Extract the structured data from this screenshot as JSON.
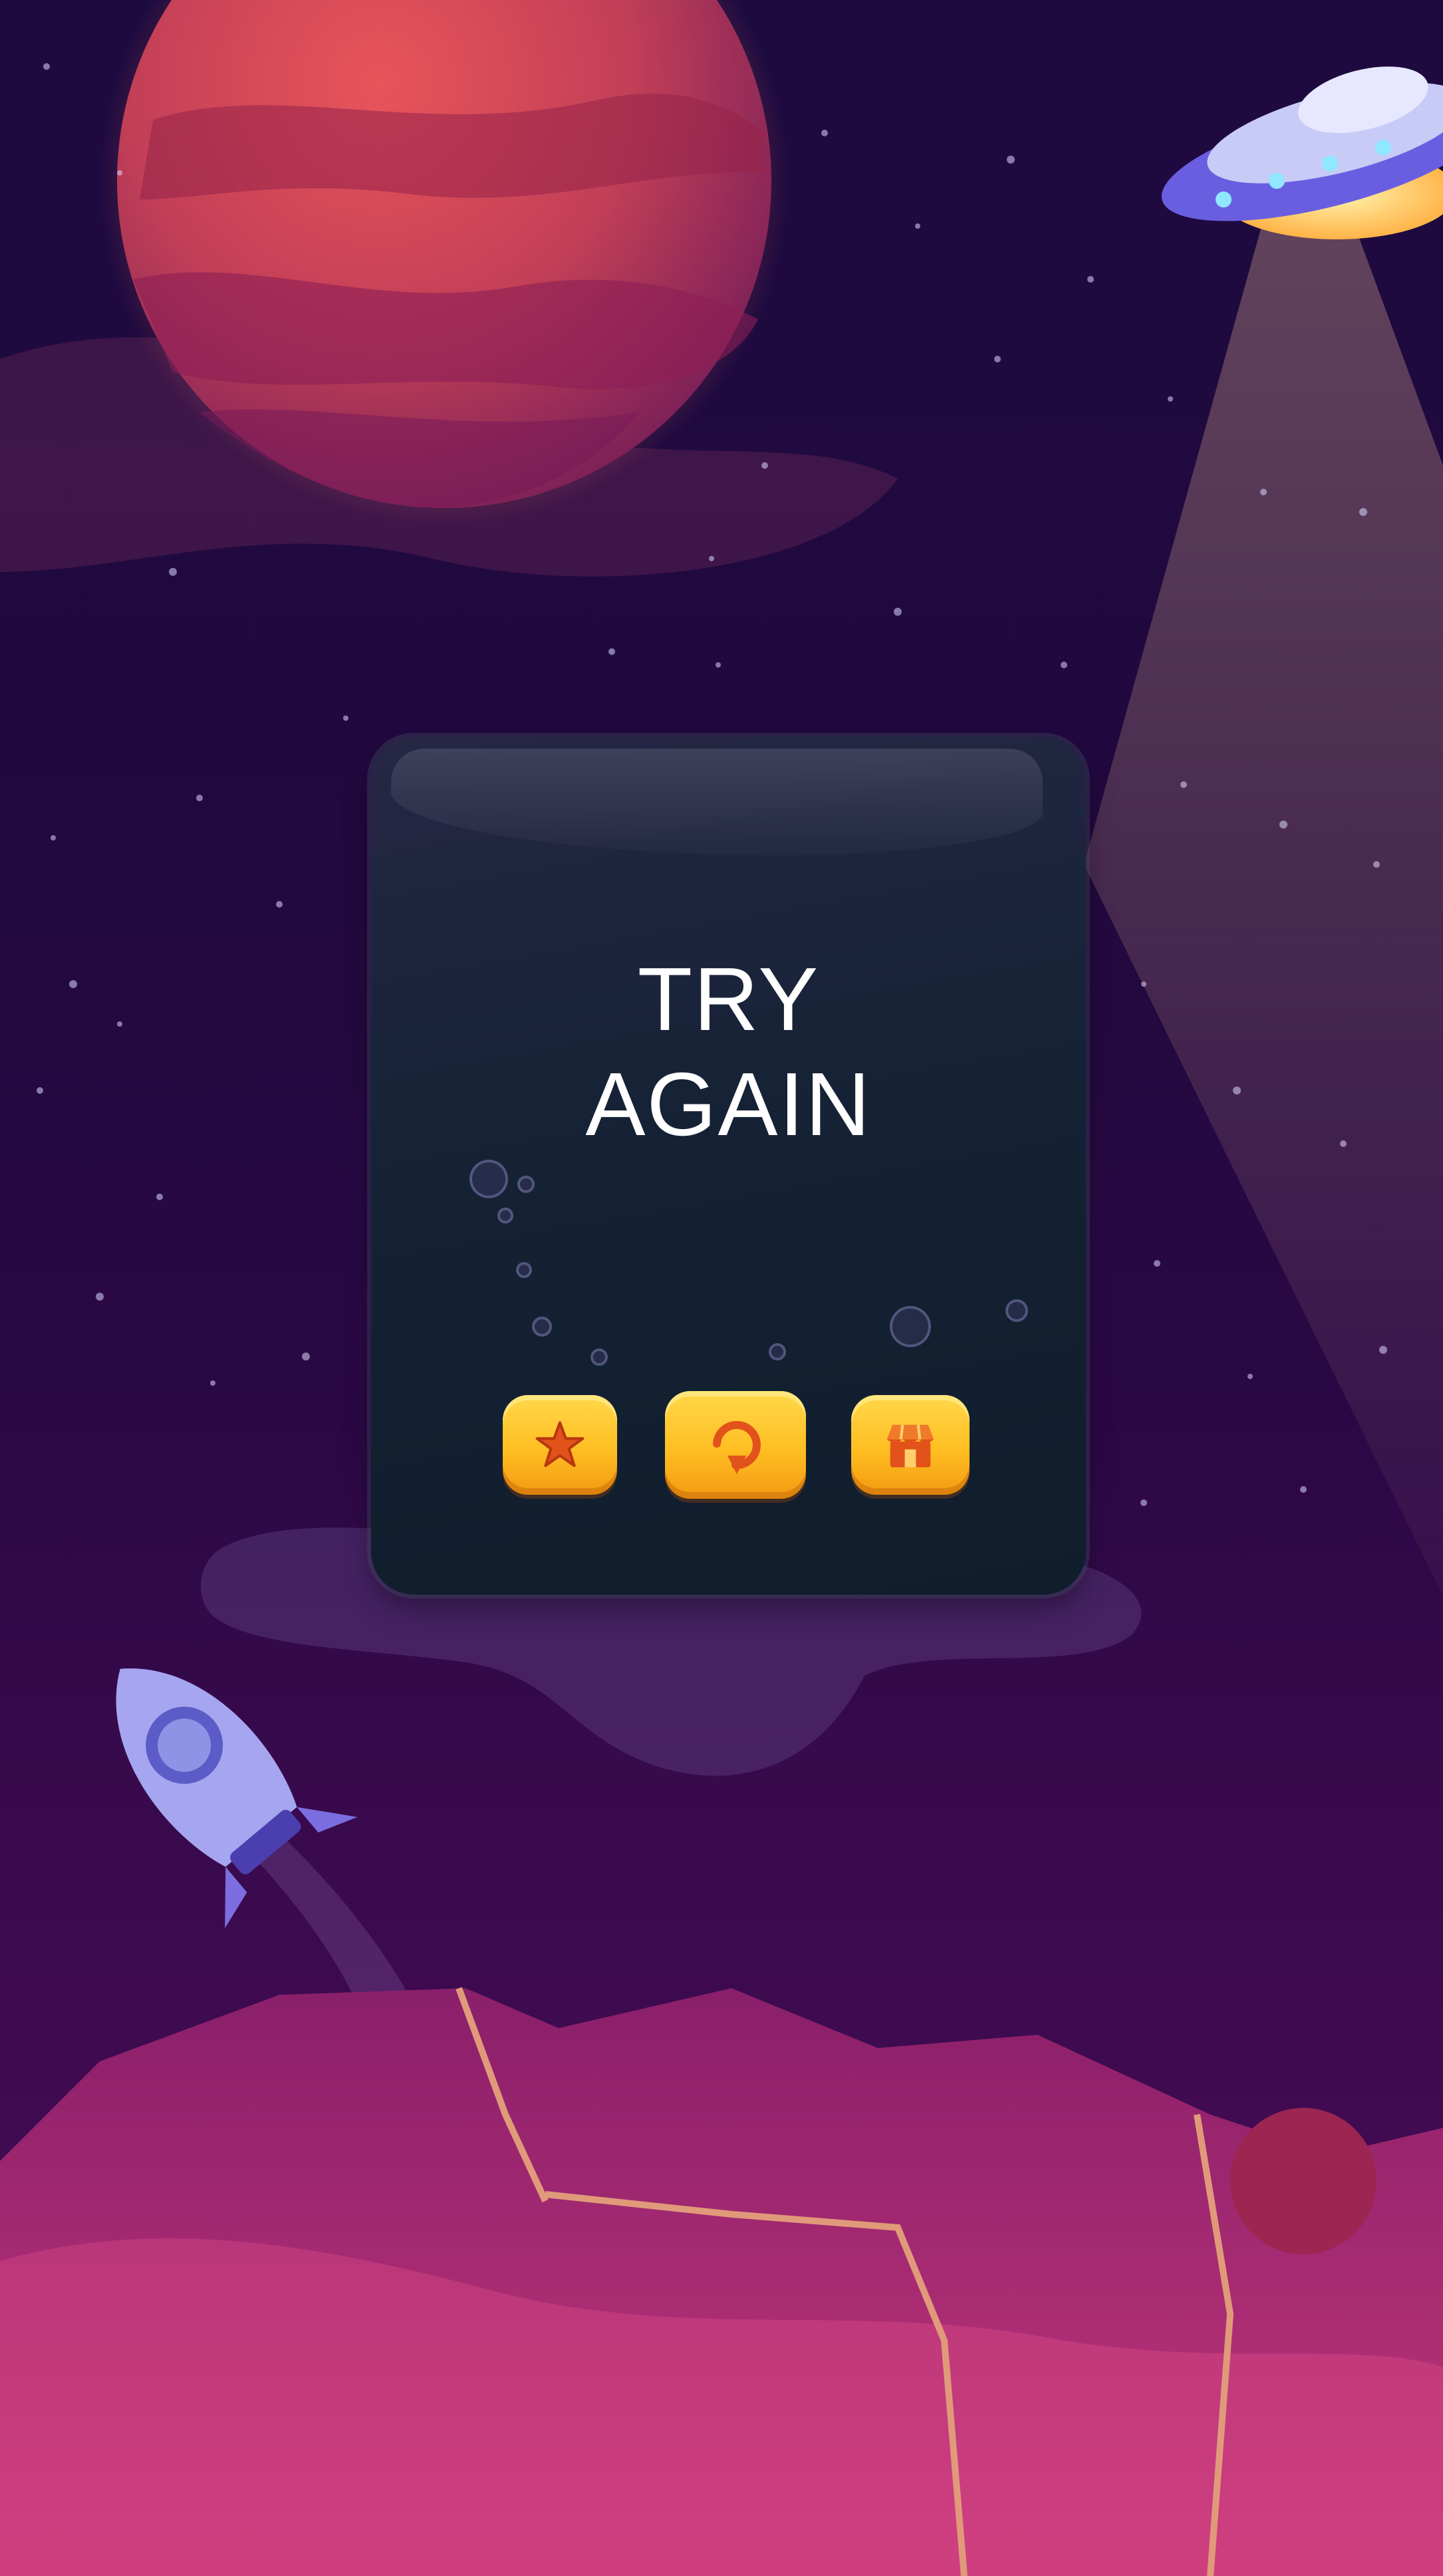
{
  "screen": {
    "title_line1": "TRY",
    "title_line2": "AGAIN"
  },
  "buttons": [
    {
      "id": "rate",
      "icon": "star-icon"
    },
    {
      "id": "retry",
      "icon": "restart-icon"
    },
    {
      "id": "shop",
      "icon": "shop-icon"
    }
  ],
  "colors": {
    "background_top": "#1d0a3f",
    "background_bottom": "#4a0c55",
    "panel": "#152235",
    "button": "#ffbe22",
    "icon": "#e2521b",
    "planet": "#d9474f",
    "title_text": "#ffffff"
  }
}
